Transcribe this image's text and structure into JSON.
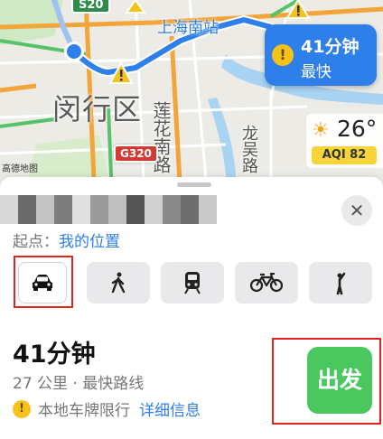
{
  "map": {
    "route_shields": {
      "s20": "S20",
      "g320": "G320"
    },
    "district_label": "闵行区",
    "station_label": "上海南站",
    "road_labels": {
      "lianhua": "莲花南路",
      "longwu": "龙吴路"
    },
    "attribution": "高德地图",
    "eta_callout": {
      "time": "41分钟",
      "note": "最快"
    },
    "weather": {
      "temperature": "26°",
      "aqi": "AQI 82",
      "icon": "sun-icon"
    },
    "colors": {
      "route": "#2f7fea",
      "road_orange": "#f3a53a",
      "road_green": "#56c26a",
      "park": "#cfe9c4",
      "water": "#a9d3f2"
    }
  },
  "sheet": {
    "destination_blurred": true,
    "origin": {
      "label": "起点：",
      "value": "我的位置"
    },
    "modes": [
      {
        "name": "car",
        "icon": "car-icon",
        "selected": true
      },
      {
        "name": "walk",
        "icon": "walking-icon",
        "selected": false
      },
      {
        "name": "transit",
        "icon": "train-icon",
        "selected": false
      },
      {
        "name": "bike",
        "icon": "bicycle-icon",
        "selected": false
      },
      {
        "name": "ride-hail",
        "icon": "hailing-person-icon",
        "selected": false
      }
    ],
    "route": {
      "time": "41分钟",
      "summary": "27 公里 · 最快路线",
      "restriction": "本地车牌限行",
      "detail_link": "详细信息"
    },
    "go_button": "出发",
    "close_icon": "close-icon"
  }
}
